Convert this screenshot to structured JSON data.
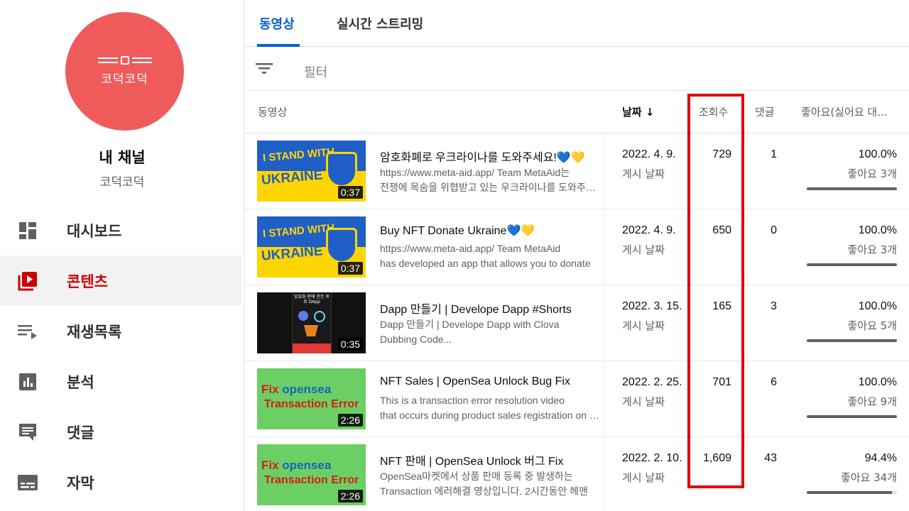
{
  "sidebar": {
    "avatar_text": "코덕코덕",
    "channel_title": "내 채널",
    "channel_name": "코덕코덕",
    "items": [
      {
        "label": "대시보드",
        "icon": "dashboard-icon"
      },
      {
        "label": "콘텐츠",
        "icon": "content-icon",
        "active": true
      },
      {
        "label": "재생목록",
        "icon": "playlist-icon"
      },
      {
        "label": "분석",
        "icon": "analytics-icon"
      },
      {
        "label": "댓글",
        "icon": "comments-icon"
      },
      {
        "label": "자막",
        "icon": "subtitles-icon"
      }
    ]
  },
  "tabs": [
    {
      "label": "동영상",
      "active": true
    },
    {
      "label": "실시간 스트리밍",
      "active": false
    }
  ],
  "filter": {
    "label": "필터",
    "icon": "filter-icon"
  },
  "table": {
    "headers": {
      "video": "동영상",
      "date": "날짜 ↓",
      "views": "조회수",
      "comments": "댓글",
      "likes": "좋아요(싫어요 대..."
    },
    "rows": [
      {
        "thumb_type": "ukraine",
        "duration": "0:37",
        "title": "암호화폐로 우크라이나를 도와주세요!💙💛",
        "desc1": "https://www.meta-aid.app/ Team MetaAid는",
        "desc2": "전쟁에 목숨을 위협받고 있는 우크라이나를 도와주기 위해",
        "date": "2022. 4. 9.",
        "date_sub": "게시 날짜",
        "views": "729",
        "comments": "1",
        "likes_pct": "100.0%",
        "likes_count": "좋아요 3개",
        "like_ratio": 1.0
      },
      {
        "thumb_type": "ukraine",
        "duration": "0:37",
        "title": "Buy NFT Donate Ukraine💙💛",
        "desc1": "https://www.meta-aid.app/ Team MetaAid",
        "desc2": "has developed an app that allows you to donate",
        "date": "2022. 4. 9.",
        "date_sub": "게시 날짜",
        "views": "650",
        "comments": "0",
        "likes_pct": "100.0%",
        "likes_count": "좋아요 3개",
        "like_ratio": 1.0
      },
      {
        "thumb_type": "dark",
        "duration": "0:35",
        "title": "Dapp 만들기 | Develope Dapp #Shorts",
        "desc1": "Dapp 만들기 | Develope Dapp with Clova",
        "desc2": "Dubbing Code...",
        "date": "2022. 3. 15.",
        "date_sub": "게시 날짜",
        "views": "165",
        "comments": "3",
        "likes_pct": "100.0%",
        "likes_count": "좋아요 5개",
        "like_ratio": 1.0
      },
      {
        "thumb_type": "green",
        "duration": "2:26",
        "title": "NFT Sales | OpenSea Unlock Bug Fix",
        "desc1": "This is a transaction error resolution video",
        "desc2": "that occurs during product sales registration on OpenSea",
        "date": "2022. 2. 25.",
        "date_sub": "게시 날짜",
        "views": "701",
        "comments": "6",
        "likes_pct": "100.0%",
        "likes_count": "좋아요 9개",
        "like_ratio": 1.0
      },
      {
        "thumb_type": "green",
        "duration": "2:26",
        "title": "NFT 판매 | OpenSea Unlock 버그 Fix",
        "desc1": "OpenSea마켓에서 상품 판매 등록 중 발생하는",
        "desc2": "Transaction 에러해결 영상입니다. 2시간동안 헤맨",
        "date": "2022. 2. 10.",
        "date_sub": "게시 날짜",
        "views": "1,609",
        "comments": "43",
        "likes_pct": "94.4%",
        "likes_count": "좋아요 34개",
        "like_ratio": 0.944
      }
    ]
  },
  "thumb_text": {
    "ukraine_line1": "I STAND WITH",
    "ukraine_line2": "UKRAINE",
    "dark_top": "암호화 판매 만든 후로 DApp",
    "green_fix": "Fix",
    "green_opensea": "opensea",
    "green_error": "Transaction Error"
  },
  "colors": {
    "accent": "#065fd4",
    "active_nav": "#cc0000",
    "avatar": "#ef5b5b",
    "highlight_box": "#e00000"
  }
}
